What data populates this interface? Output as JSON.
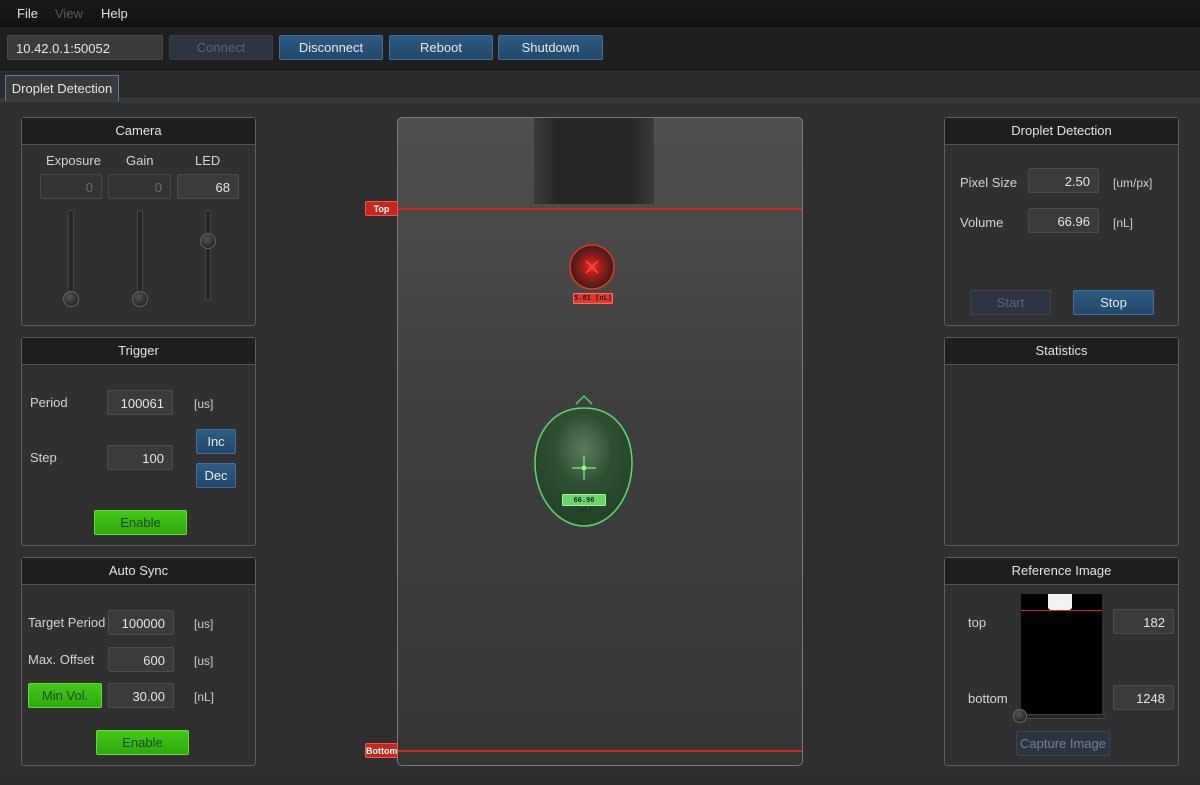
{
  "menu": {
    "file": "File",
    "view": "View",
    "help": "Help"
  },
  "toolbar": {
    "address": "10.42.0.1:50052",
    "connect": "Connect",
    "disconnect": "Disconnect",
    "reboot": "Reboot",
    "shutdown": "Shutdown"
  },
  "tabs": {
    "active": "Droplet Detection"
  },
  "camera": {
    "title": "Camera",
    "exposure_label": "Exposure",
    "exposure_value": "0",
    "gain_label": "Gain",
    "gain_value": "0",
    "led_label": "LED",
    "led_value": "68"
  },
  "trigger": {
    "title": "Trigger",
    "period_label": "Period",
    "period_value": "100061",
    "period_unit": "[us]",
    "step_label": "Step",
    "step_value": "100",
    "inc": "Inc",
    "dec": "Dec",
    "enable": "Enable"
  },
  "auto_sync": {
    "title": "Auto Sync",
    "target_label": "Target Period",
    "target_value": "100000",
    "target_unit": "[us]",
    "offset_label": "Max. Offset",
    "offset_value": "600",
    "offset_unit": "[us]",
    "minvol_button": "Min Vol.",
    "minvol_value": "30.00",
    "minvol_unit": "[nL]",
    "enable": "Enable"
  },
  "viewer": {
    "top_marker": "Top",
    "bottom_marker": "Bottom",
    "small_droplet_label": "5.81 [nL]",
    "large_droplet_label": "66.96 [nL]"
  },
  "droplet_detection": {
    "title": "Droplet Detection",
    "pixel_label": "Pixel Size",
    "pixel_value": "2.50",
    "pixel_unit": "[um/px]",
    "volume_label": "Volume",
    "volume_value": "66.96",
    "volume_unit": "[nL]",
    "start": "Start",
    "stop": "Stop"
  },
  "statistics": {
    "title": "Statistics"
  },
  "reference": {
    "title": "Reference Image",
    "top_label": "top",
    "top_value": "182",
    "bottom_label": "bottom",
    "bottom_value": "1248",
    "capture": "Capture Image"
  },
  "colors": {
    "accent_blue": "#2e5b84",
    "enable_green": "#3cbf14",
    "marker_red": "#d0241c",
    "droplet_green": "#62d66a"
  }
}
